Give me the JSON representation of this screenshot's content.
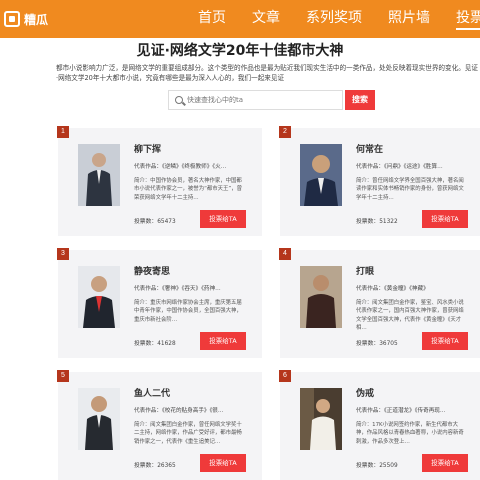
{
  "header": {
    "logo_text": "糟瓜",
    "logo_icon": "box-icon",
    "nav": [
      {
        "label": "首页"
      },
      {
        "label": "文章"
      },
      {
        "label": "系列奖项"
      },
      {
        "label": "照片墙"
      },
      {
        "label": "投票专"
      }
    ],
    "brand_color": "#f08a1f"
  },
  "page": {
    "title": "见证·网络文学20年十佳都市大神",
    "intro": "都市小说影响力广泛，是网络文学的重要组成部分。这个类型的作品也是最为贴近我们现实生活中的一类作品，处处反映着现实世界的变化。见证·网络文学20年十大都市小说，究竟有哪些是最为深入人心的，我们一起来见证"
  },
  "search": {
    "placeholder": "快速查找心中的ta",
    "button_label": "搜索",
    "button_color": "#ef3a3a"
  },
  "vote_label": "投票给TA",
  "candidates": [
    {
      "rank": "1",
      "name": "柳下挥",
      "works": "代表作品：《逆鳞》《终极教师》《火…",
      "bio": "简介：中国作协会员，著名大神作家，中国都市小说代表作家之一，被誉为“都市天王”，曾荣获网络文学年十二主持…",
      "votes": "投票数：65473"
    },
    {
      "rank": "2",
      "name": "何常在",
      "works": "代表作品：《问鼎》《运途》《胜算…",
      "bio": "简介：曾任网络文学界全国百强大神，著名阅读作家和实体书畅销作家的身份，曾获网络文学年十二主持…",
      "votes": "投票数：51322"
    },
    {
      "rank": "3",
      "name": "静夜寄思",
      "works": "代表作品：《奢神》《吞天》《药神…",
      "bio": "简介：重庆市网络作家协会主席，重庆第五届中青年作家，中国作协会员，全国百强大神，重庆市新社会阶…",
      "votes": "投票数：41628"
    },
    {
      "rank": "4",
      "name": "打眼",
      "works": "代表作品：《黄金瞳》《神藏》",
      "bio": "简介：阅文集团白金作家，鉴宝、风水类小说代表作家之一，国内百强大神作家，曾获网络文学全国百强大神，代表作《黄金瞳》《天才相…",
      "votes": "投票数：36705"
    },
    {
      "rank": "5",
      "name": "鱼人二代",
      "works": "代表作品：《校花的贴身高手》《很…",
      "bio": "简介：阅文集团白金作家，曾任网络文学奖十二主持，网络作家，作品广受好评，都市最畅销作家之一，代表作《重生追美记…",
      "votes": "投票数：26365"
    },
    {
      "rank": "6",
      "name": "伪戒",
      "works": "代表作品：《正道潜龙》《传奇再现…",
      "bio": "简介：17K小说网签约作家，新生代都市大神，作品风格以青春热血著称，小说内容新奇刺激，作品多次登上…",
      "votes": "投票数：25509"
    }
  ]
}
